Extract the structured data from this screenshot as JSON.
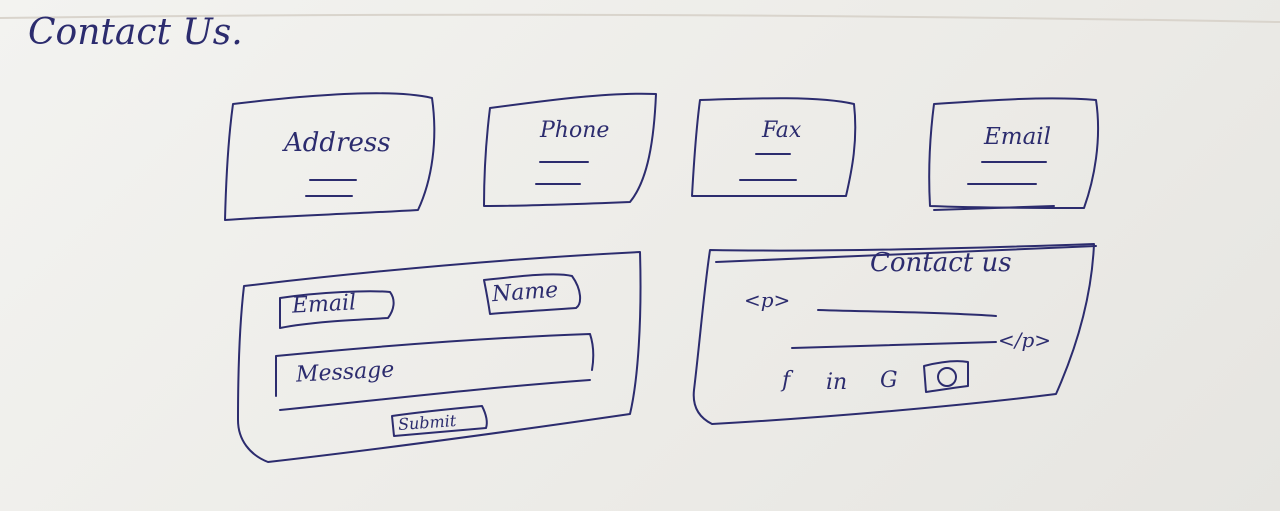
{
  "page_title": "Contact Us.",
  "info_cards": [
    {
      "label": "Address",
      "icon": "address-icon"
    },
    {
      "label": "Phone",
      "icon": "phone-icon"
    },
    {
      "label": "Fax",
      "icon": "fax-icon"
    },
    {
      "label": "Email",
      "icon": "email-icon"
    }
  ],
  "form": {
    "email_placeholder": "Email",
    "name_placeholder": "Name",
    "message_placeholder": "Message",
    "submit_label": "Submit"
  },
  "contact_panel": {
    "title": "Contact us",
    "p_open": "<p>",
    "p_close": "</p>",
    "social": [
      {
        "label": "f",
        "icon": "facebook-icon"
      },
      {
        "label": "in",
        "icon": "linkedin-icon"
      },
      {
        "label": "G",
        "icon": "google-icon"
      },
      {
        "label": "",
        "icon": "instagram-icon"
      }
    ]
  },
  "colors": {
    "ink": "#2c2c6e",
    "paper": "#efefec",
    "wood": "#c4a887"
  }
}
